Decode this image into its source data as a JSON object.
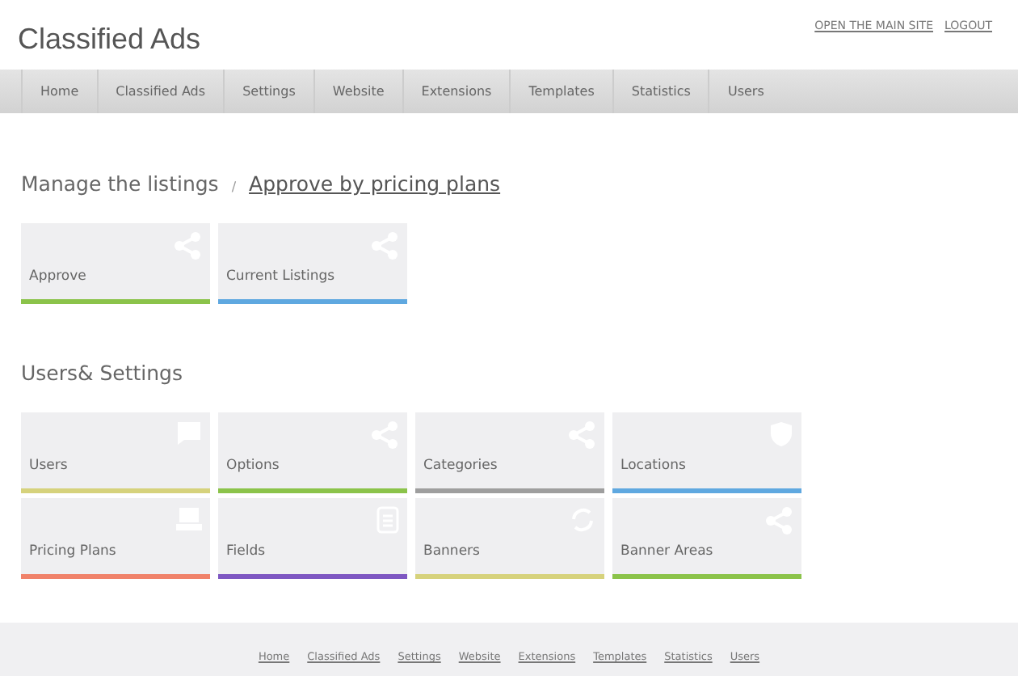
{
  "header": {
    "title": "Classified Ads",
    "links": [
      "OPEN THE MAIN SITE",
      "LOGOUT"
    ]
  },
  "nav": [
    "Home",
    "Classified Ads",
    "Settings",
    "Website",
    "Extensions",
    "Templates",
    "Statistics",
    "Users"
  ],
  "breadcrumb": {
    "current": "Manage the listings",
    "separator": "/",
    "link": "Approve by pricing plans"
  },
  "listing_tiles": [
    {
      "label": "Approve",
      "color": "#8bc34a"
    },
    {
      "label": "Current Listings",
      "color": "#5fa8e0"
    }
  ],
  "settings_heading": "Users& Settings",
  "settings_tiles": [
    {
      "label": "Users",
      "color": "#d6d27c"
    },
    {
      "label": "Options",
      "color": "#8bc34a"
    },
    {
      "label": "Categories",
      "color": "#9e9e9e"
    },
    {
      "label": "Locations",
      "color": "#5fa8e0"
    },
    {
      "label": "Pricing Plans",
      "color": "#f0826a"
    },
    {
      "label": "Fields",
      "color": "#7e57c2"
    },
    {
      "label": "Banners",
      "color": "#d6d27c"
    },
    {
      "label": "Banner Areas",
      "color": "#8bc34a"
    }
  ],
  "footer_links": [
    "Home",
    "Classified Ads",
    "Settings",
    "Website",
    "Extensions",
    "Templates",
    "Statistics",
    "Users"
  ]
}
